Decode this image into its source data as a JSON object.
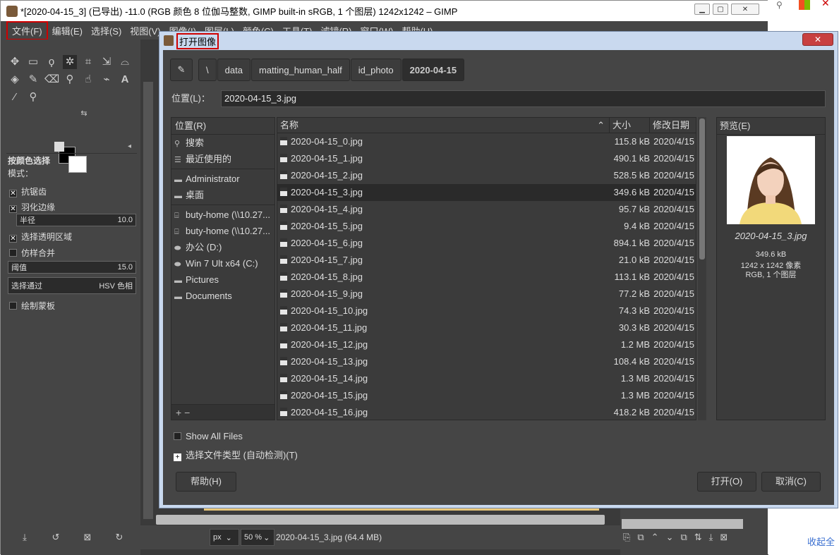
{
  "main_window": {
    "title": "*[2020-04-15_3] (已导出) -11.0 (RGB 颜色 8 位伽马整数, GIMP built-in sRGB, 1 个图层) 1242x1242 – GIMP",
    "menu": [
      "文件(F)",
      "编辑(E)",
      "选择(S)",
      "视图(V)",
      "图像(I)",
      "图层(L)",
      "颜色(C)",
      "工具(T)",
      "滤镜(R)",
      "窗口(W)",
      "帮助(H)"
    ]
  },
  "toolbox": {
    "tool_title": "按颜色选择",
    "mode_label": "模式：",
    "antialias": "抗锯齿",
    "feather": "羽化边缘",
    "radius_label": "半径",
    "radius_value": "10.0",
    "select_transparent": "选择透明区域",
    "sample_merged": "仿样合并",
    "threshold_label": "阈值",
    "threshold_value": "15.0",
    "select_by_label": "选择通过",
    "select_by_value": "HSV 色相",
    "draw_mask": "绘制蒙板"
  },
  "statusbar": {
    "unit": "px",
    "zoom": "50 %",
    "info": "2020-04-15_3.jpg (64.4 MB)"
  },
  "right_edge": {
    "collapse_text": "收起全"
  },
  "dialog": {
    "title": "打开图像",
    "breadcrumb": [
      "\\",
      "data",
      "matting_human_half",
      "id_photo",
      "2020-04-15"
    ],
    "location_label": "位置(L)：",
    "location_value": "2020-04-15_3.jpg",
    "places": {
      "header": "位置(R)",
      "items": [
        {
          "icon": "search-icon",
          "label": "搜索"
        },
        {
          "icon": "recent-icon",
          "label": "最近使用的"
        },
        {
          "icon": "folder-icon",
          "label": "Administrator"
        },
        {
          "icon": "folder-icon",
          "label": "桌面"
        },
        {
          "icon": "network-drive-icon",
          "label": "buty-home (\\\\10.27..."
        },
        {
          "icon": "network-drive-icon",
          "label": "buty-home (\\\\10.27..."
        },
        {
          "icon": "drive-icon",
          "label": "办公 (D:)"
        },
        {
          "icon": "drive-icon",
          "label": "Win 7 Ult x64 (C:)"
        },
        {
          "icon": "folder-icon",
          "label": "Pictures"
        },
        {
          "icon": "folder-icon",
          "label": "Documents"
        }
      ],
      "footer": "+ −"
    },
    "columns": {
      "name": "名称",
      "size": "大小",
      "date": "修改日期"
    },
    "files": [
      {
        "name": "2020-04-15_0.jpg",
        "size": "115.8 kB",
        "date": "2020/4/15"
      },
      {
        "name": "2020-04-15_1.jpg",
        "size": "490.1 kB",
        "date": "2020/4/15"
      },
      {
        "name": "2020-04-15_2.jpg",
        "size": "528.5 kB",
        "date": "2020/4/15"
      },
      {
        "name": "2020-04-15_3.jpg",
        "size": "349.6 kB",
        "date": "2020/4/15"
      },
      {
        "name": "2020-04-15_4.jpg",
        "size": "95.7 kB",
        "date": "2020/4/15"
      },
      {
        "name": "2020-04-15_5.jpg",
        "size": "9.4 kB",
        "date": "2020/4/15"
      },
      {
        "name": "2020-04-15_6.jpg",
        "size": "894.1 kB",
        "date": "2020/4/15"
      },
      {
        "name": "2020-04-15_7.jpg",
        "size": "21.0 kB",
        "date": "2020/4/15"
      },
      {
        "name": "2020-04-15_8.jpg",
        "size": "113.1 kB",
        "date": "2020/4/15"
      },
      {
        "name": "2020-04-15_9.jpg",
        "size": "77.2 kB",
        "date": "2020/4/15"
      },
      {
        "name": "2020-04-15_10.jpg",
        "size": "74.3 kB",
        "date": "2020/4/15"
      },
      {
        "name": "2020-04-15_11.jpg",
        "size": "30.3 kB",
        "date": "2020/4/15"
      },
      {
        "name": "2020-04-15_12.jpg",
        "size": "1.2 MB",
        "date": "2020/4/15"
      },
      {
        "name": "2020-04-15_13.jpg",
        "size": "108.4 kB",
        "date": "2020/4/15"
      },
      {
        "name": "2020-04-15_14.jpg",
        "size": "1.3 MB",
        "date": "2020/4/15"
      },
      {
        "name": "2020-04-15_15.jpg",
        "size": "1.3 MB",
        "date": "2020/4/15"
      },
      {
        "name": "2020-04-15_16.jpg",
        "size": "418.2 kB",
        "date": "2020/4/15"
      }
    ],
    "preview": {
      "header": "预览(E)",
      "filename": "2020-04-15_3.jpg",
      "size": "349.6 kB",
      "dims": "1242 x 1242 像素",
      "mode": "RGB, 1 个图层"
    },
    "show_all_files": "Show All Files",
    "file_type": "选择文件类型 (自动检测)(T)",
    "help_button": "帮助(H)",
    "open_button": "打开(O)",
    "cancel_button": "取消(C)"
  }
}
